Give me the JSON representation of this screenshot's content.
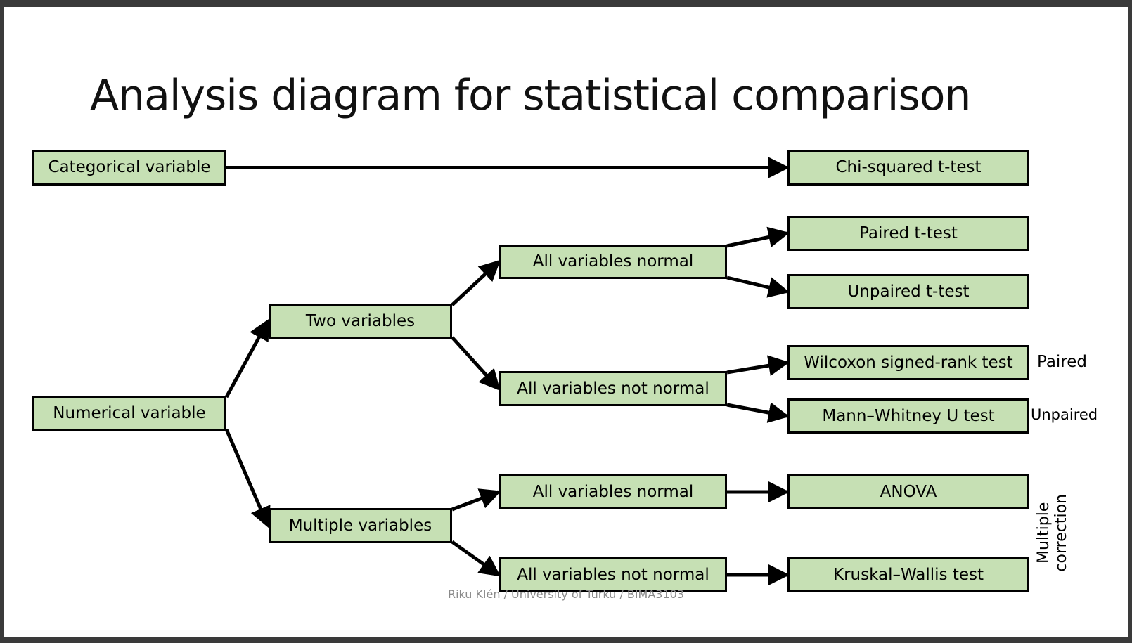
{
  "title": "Analysis diagram for statistical comparison",
  "colors": {
    "node_fill": "#c6e0b4",
    "node_border": "#000000",
    "arrow": "#000000",
    "footer_text": "#8a8a8a"
  },
  "nodes": {
    "categorical_variable": "Categorical variable",
    "chi_squared": "Chi-squared t-test",
    "numerical_variable": "Numerical variable",
    "two_variables": "Two variables",
    "multiple_variables": "Multiple variables",
    "two_normal": "All variables normal",
    "two_not_normal": "All variables not normal",
    "multi_normal": "All variables normal",
    "multi_not_normal": "All variables not normal",
    "paired_t_test": "Paired t-test",
    "unpaired_t_test": "Unpaired t-test",
    "wilcoxon": "Wilcoxon signed-rank test",
    "mann_whitney": "Mann–Whitney U test",
    "anova": "ANOVA",
    "kruskal_wallis": "Kruskal–Wallis test"
  },
  "side_labels": {
    "paired": "Paired",
    "unpaired": "Unpaired",
    "multiple_correction_line1": "Multiple",
    "multiple_correction_line2": "correction"
  },
  "edges": [
    [
      "categorical_variable",
      "chi_squared"
    ],
    [
      "numerical_variable",
      "two_variables"
    ],
    [
      "numerical_variable",
      "multiple_variables"
    ],
    [
      "two_variables",
      "two_normal"
    ],
    [
      "two_variables",
      "two_not_normal"
    ],
    [
      "two_normal",
      "paired_t_test"
    ],
    [
      "two_normal",
      "unpaired_t_test"
    ],
    [
      "two_not_normal",
      "wilcoxon"
    ],
    [
      "two_not_normal",
      "mann_whitney"
    ],
    [
      "multiple_variables",
      "multi_normal"
    ],
    [
      "multiple_variables",
      "multi_not_normal"
    ],
    [
      "multi_normal",
      "anova"
    ],
    [
      "multi_not_normal",
      "kruskal_wallis"
    ]
  ],
  "footer": "Riku Klén / University of Turku / BIMA3103"
}
